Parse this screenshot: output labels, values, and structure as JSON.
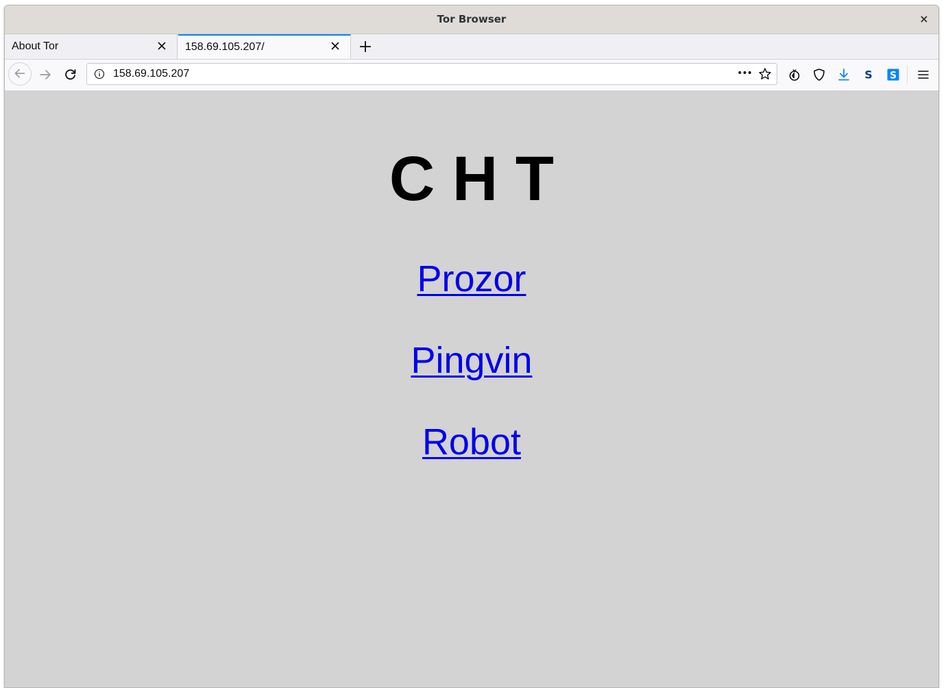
{
  "window": {
    "title": "Tor Browser",
    "close_glyph": "×"
  },
  "tabs": [
    {
      "label": "About Tor",
      "active": false
    },
    {
      "label": "158.69.105.207/",
      "active": true
    }
  ],
  "navbar": {
    "url": "158.69.105.207",
    "more_glyph": "•••",
    "toolbar_icons": [
      "onion-icon",
      "shield-icon",
      "download-icon",
      "s-extension-icon",
      "s-extension-blue-icon",
      "hamburger-menu-icon"
    ],
    "s_letter": "S"
  },
  "colors": {
    "accent": "#0a84ff",
    "content_bg": "#d3d3d3",
    "link": "#0000ee",
    "download_blue": "#0a84ff",
    "s_dark": "#0b3a82"
  },
  "page": {
    "heading": "C H T",
    "links": [
      "Prozor",
      "Pingvin",
      "Robot"
    ]
  }
}
